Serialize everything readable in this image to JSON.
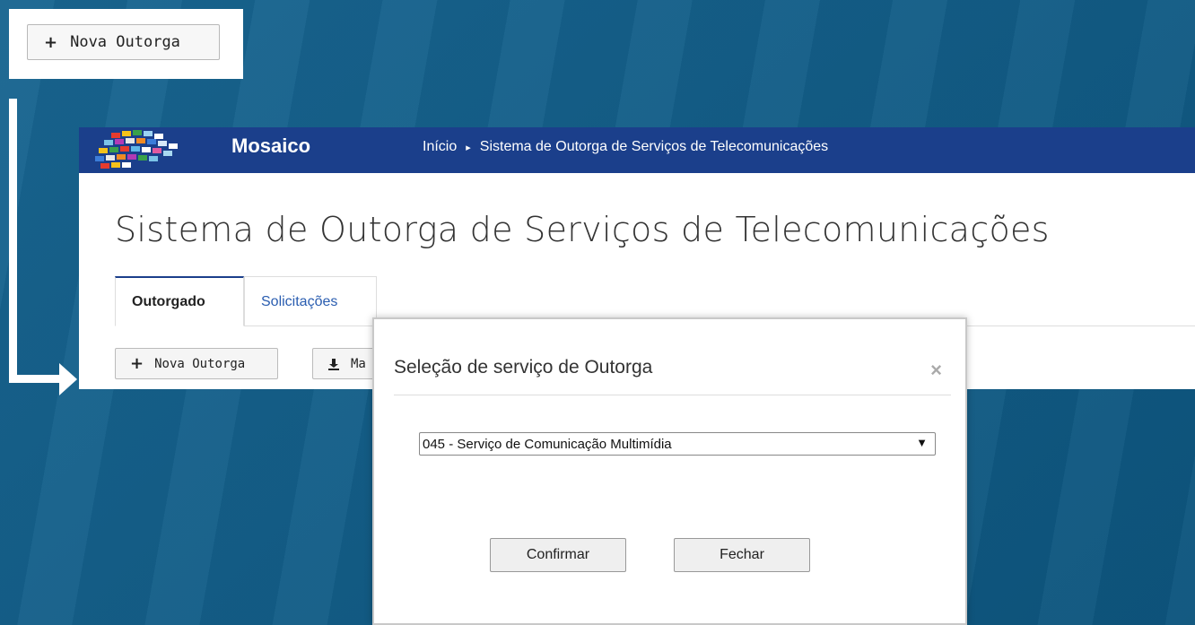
{
  "callout": {
    "button_label": "Nova Outorga"
  },
  "header": {
    "brand": "Mosaico",
    "breadcrumb": [
      "Início",
      "Sistema de Outorga de Serviços de Telecomunicações"
    ]
  },
  "page": {
    "title": "Sistema de Outorga de Serviços de Telecomunicações"
  },
  "tabs": [
    {
      "label": "Outorgado",
      "active": true
    },
    {
      "label": "Solicitações",
      "active": false
    }
  ],
  "toolbar": {
    "nova_label": "Nova Outorga",
    "ma_label": "Ma"
  },
  "modal": {
    "title": "Seleção de serviço de Outorga",
    "close_glyph": "×",
    "select_value": "045 - Serviço de Comunicação Multimídia",
    "confirm_label": "Confirmar",
    "close_label": "Fechar"
  },
  "colors": {
    "background": "#0f5f8c",
    "topbar": "#1b3f8b",
    "link": "#2a5db0"
  }
}
